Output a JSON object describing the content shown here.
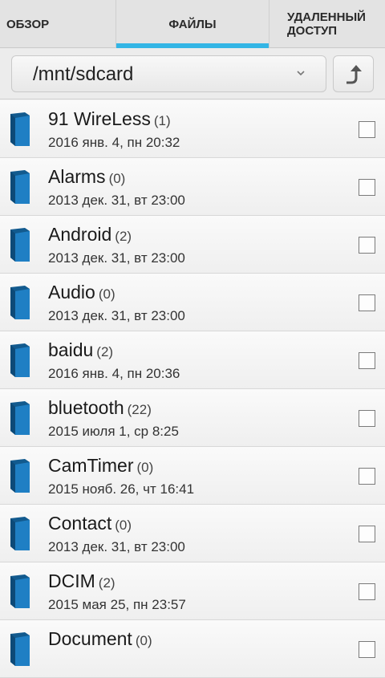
{
  "tabs": [
    {
      "label": "ОБЗОР",
      "active": false
    },
    {
      "label": "ФАЙЛЫ",
      "active": true
    },
    {
      "label_line1": "УДАЛЕННЫЙ",
      "label_line2": "ДОСТУП",
      "active": false
    }
  ],
  "path_bar": {
    "current_path": "/mnt/sdcard",
    "dropdown_icon": "chevron-down-icon",
    "up_button_icon": "up-arrow-icon"
  },
  "colors": {
    "accent": "#33b5e5",
    "folder": "#1f7fc4"
  },
  "files": [
    {
      "name": "91 WireLess",
      "count": "(1)",
      "date": "2016 янв. 4, пн 20:32"
    },
    {
      "name": "Alarms",
      "count": "(0)",
      "date": "2013 дек. 31, вт 23:00"
    },
    {
      "name": "Android",
      "count": "(2)",
      "date": "2013 дек. 31, вт 23:00"
    },
    {
      "name": "Audio",
      "count": "(0)",
      "date": "2013 дек. 31, вт 23:00"
    },
    {
      "name": "baidu",
      "count": "(2)",
      "date": "2016 янв. 4, пн 20:36"
    },
    {
      "name": "bluetooth",
      "count": "(22)",
      "date": "2015 июля 1, ср 8:25"
    },
    {
      "name": "CamTimer",
      "count": "(0)",
      "date": "2015 нояб. 26, чт 16:41"
    },
    {
      "name": "Contact",
      "count": "(0)",
      "date": "2013 дек. 31, вт 23:00"
    },
    {
      "name": "DCIM",
      "count": "(2)",
      "date": "2015 мая 25, пн 23:57"
    },
    {
      "name": "Document",
      "count": "(0)",
      "date": ""
    }
  ]
}
